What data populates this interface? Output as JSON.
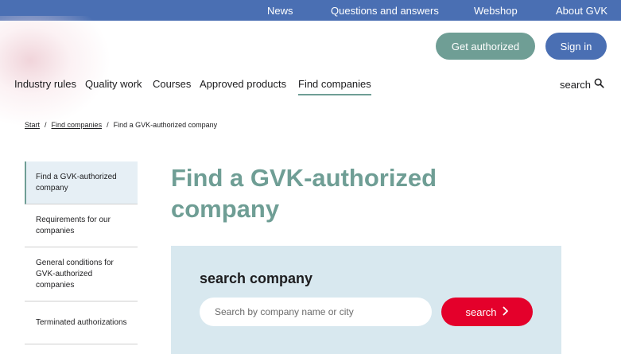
{
  "topbar": {
    "links": [
      "News",
      "Questions and answers",
      "Webshop",
      "About GVK"
    ]
  },
  "header": {
    "get_authorized": "Get authorized",
    "sign_in": "Sign in"
  },
  "nav": {
    "items": [
      "Industry rules",
      "Quality work",
      "Courses",
      "Approved products",
      "Find companies"
    ],
    "active": "Find companies",
    "search_label": "search"
  },
  "breadcrumb": {
    "items": [
      "Start",
      "Find companies",
      "Find a GVK-authorized company"
    ],
    "separator": "/"
  },
  "sidebar": {
    "items": [
      {
        "label": "Find a GVK-authorized company",
        "active": true
      },
      {
        "label": "Requirements for our companies",
        "active": false
      },
      {
        "label": "General conditions for GVK-authorized companies",
        "active": false
      },
      {
        "label": "Terminated authorizations",
        "active": false
      }
    ]
  },
  "page": {
    "title": "Find a GVK-authorized company"
  },
  "search_panel": {
    "heading": "search company",
    "placeholder": "Search by company name or city",
    "button_label": "search"
  },
  "colors": {
    "topbar": "#4a6fb3",
    "accent_green": "#6f9e95",
    "primary_blue": "#4a6fb3",
    "search_red": "#e4002b",
    "panel_bg": "#d8e8ef"
  }
}
